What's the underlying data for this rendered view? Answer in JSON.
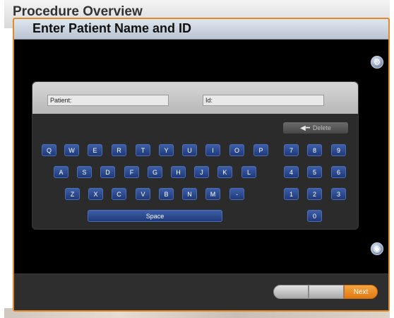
{
  "background": {
    "title": "Procedure Overview"
  },
  "dialog": {
    "title": "Enter Patient Name and ID",
    "fields": {
      "patient_label": "Patient",
      "id_label": "Id"
    },
    "delete_label": "Delete",
    "keyboard": {
      "row1": [
        "Q",
        "W",
        "E",
        "R",
        "T",
        "Y",
        "U",
        "I",
        "O",
        "P"
      ],
      "row2": [
        "A",
        "S",
        "D",
        "F",
        "G",
        "H",
        "J",
        "K",
        "L"
      ],
      "row3": [
        "Z",
        "X",
        "C",
        "V",
        "B",
        "N",
        "M",
        "-"
      ],
      "space_label": "Space",
      "numpad": [
        "7",
        "8",
        "9",
        "4",
        "5",
        "6",
        "1",
        "2",
        "3",
        "0"
      ]
    },
    "footer": {
      "next_label": "Next"
    },
    "icons": [
      "settings-icon",
      "camera-icon",
      "arrow-left-icon"
    ]
  },
  "colors": {
    "accent_orange": "#e07a12",
    "key_blue": "#2a4a90",
    "dialog_border": "#e08a2c"
  }
}
